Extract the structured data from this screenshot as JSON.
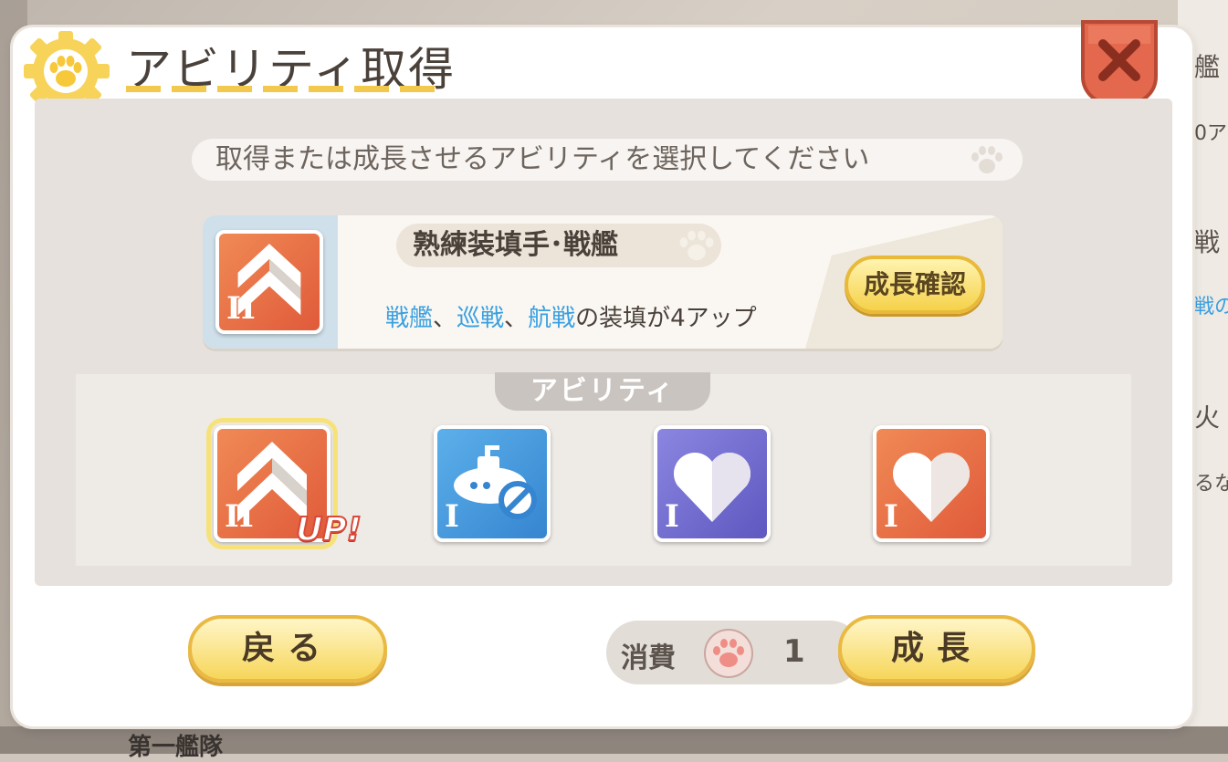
{
  "dialog": {
    "title": "アビリティ取得",
    "instruction": "取得または成長させるアビリティを選択してください"
  },
  "selected_ability": {
    "name": "熟練装填手･戦艦",
    "description_parts": [
      {
        "text": "戦艦",
        "highlight": true
      },
      {
        "text": "、",
        "highlight": false
      },
      {
        "text": "巡戦",
        "highlight": true
      },
      {
        "text": "、",
        "highlight": false
      },
      {
        "text": "航戦",
        "highlight": true
      },
      {
        "text": "の装填が4アップ",
        "highlight": false
      }
    ],
    "level": "II",
    "confirm_label": "成長確認"
  },
  "abilities": {
    "label": "アビリティ",
    "items": [
      {
        "level": "II",
        "color": "orange",
        "icon": "chevron-up-icon",
        "selected": true,
        "badge": "UP!"
      },
      {
        "level": "I",
        "color": "blue",
        "icon": "submarine-block-icon",
        "selected": false
      },
      {
        "level": "I",
        "color": "purple",
        "icon": "heart-icon",
        "selected": false
      },
      {
        "level": "I",
        "color": "orange",
        "icon": "heart-icon",
        "selected": false
      }
    ]
  },
  "footer": {
    "back_label": "戻る",
    "cost_label": "消費",
    "cost_value": "1",
    "grow_label": "成長"
  },
  "background": {
    "right_texts": [
      "艦",
      "0ア",
      "戦",
      "戦の",
      "火",
      "るな"
    ],
    "bottom_label": "第一艦隊"
  },
  "colors": {
    "accent_yellow": "#f5d24a",
    "highlight_blue": "#3aa0e0",
    "close_red": "#e4684e"
  }
}
